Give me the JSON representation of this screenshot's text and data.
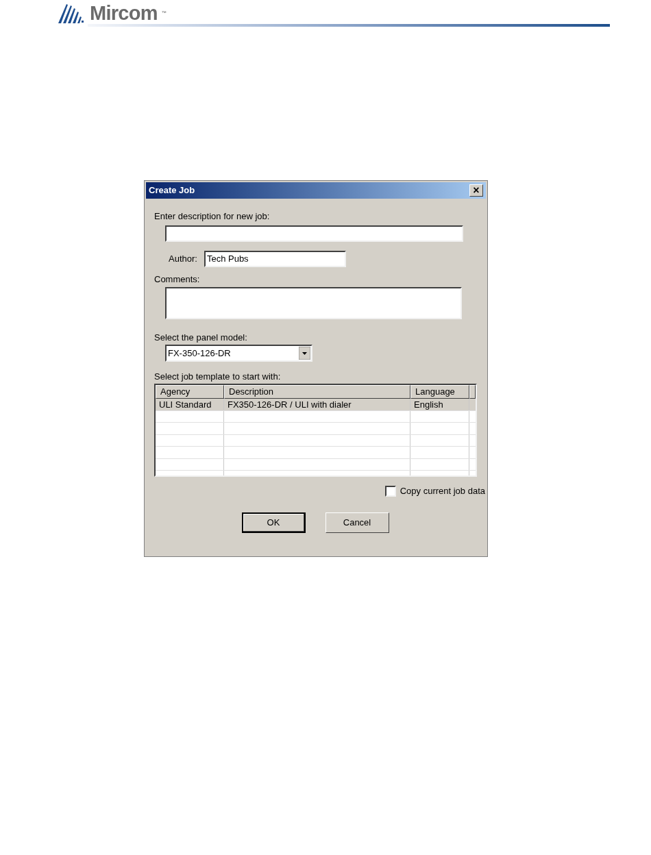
{
  "header": {
    "brand": "Mircom",
    "trademark": "™"
  },
  "dialog": {
    "title": "Create Job",
    "close": "×",
    "description_label": "Enter description for new job:",
    "author_label": "Author:",
    "author_value": "Tech Pubs",
    "comments_label": "Comments:",
    "panel_label": "Select the panel model:",
    "panel_value": "FX-350-126-DR",
    "template_label": "Select job template to start with:",
    "table": {
      "columns": [
        "Agency",
        "Description",
        "Language"
      ],
      "rows": [
        {
          "cells": [
            "ULI Standard",
            "FX350-126-DR / ULI with dialer",
            "English"
          ],
          "selected": true
        }
      ]
    },
    "copy_checkbox": {
      "label": "Copy current job data",
      "checked": false
    },
    "buttons": [
      {
        "label": "OK",
        "default": true
      },
      {
        "label": "Cancel",
        "default": false
      }
    ]
  }
}
